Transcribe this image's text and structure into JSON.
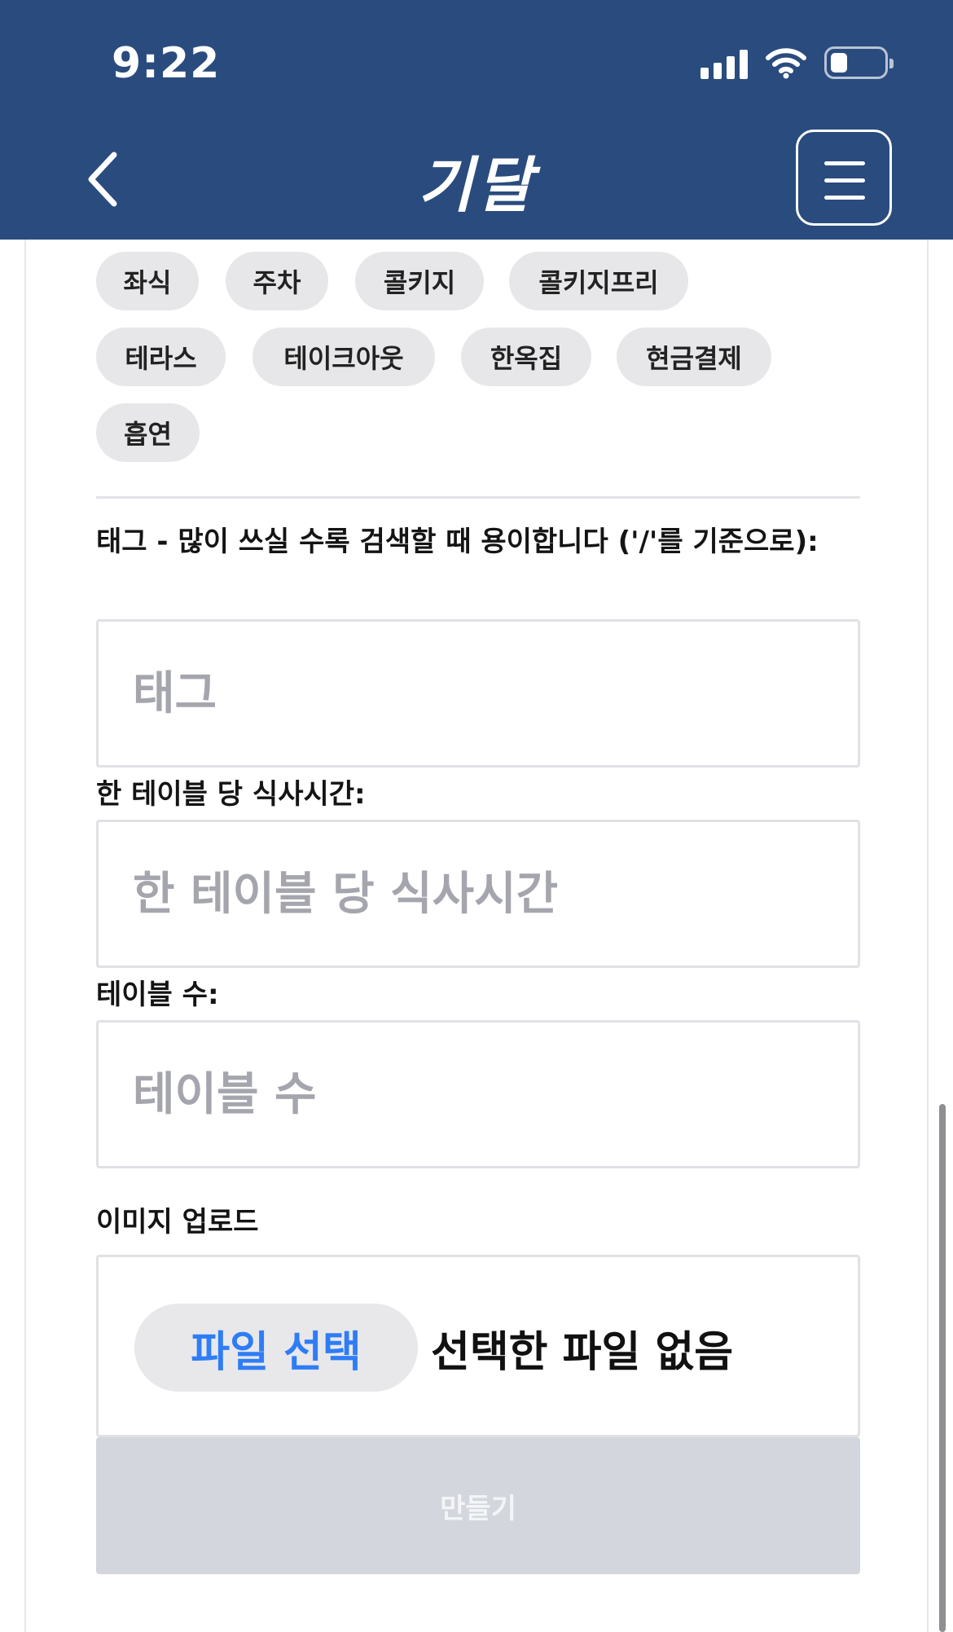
{
  "status_bar": {
    "time": "9:22"
  },
  "nav": {
    "title": "기달"
  },
  "amenity_chips": [
    "좌식",
    "주차",
    "콜키지",
    "콜키지프리",
    "테라스",
    "테이크아웃",
    "한옥집",
    "현금결제",
    "흡연"
  ],
  "form": {
    "tags": {
      "label": "태그 - 많이 쓰실 수록 검색할 때 용이합니다 ('/'를 기준으로):",
      "placeholder": "태그",
      "value": ""
    },
    "meal_time": {
      "label": "한 테이블 당 식사시간:",
      "placeholder": "한 테이블 당 식사시간",
      "value": ""
    },
    "table_count": {
      "label": "테이블 수:",
      "placeholder": "테이블 수",
      "value": ""
    },
    "image_upload": {
      "label": "이미지 업로드",
      "button_label": "파일 선택",
      "status": "선택한 파일 없음"
    },
    "submit_label": "만들기"
  },
  "colors": {
    "header_bg": "#2a4b7e",
    "chip_bg": "#e7e7ea",
    "file_button_text": "#2f7df6",
    "submit_bg": "#d3d6dd",
    "placeholder": "#a5a6ad"
  }
}
